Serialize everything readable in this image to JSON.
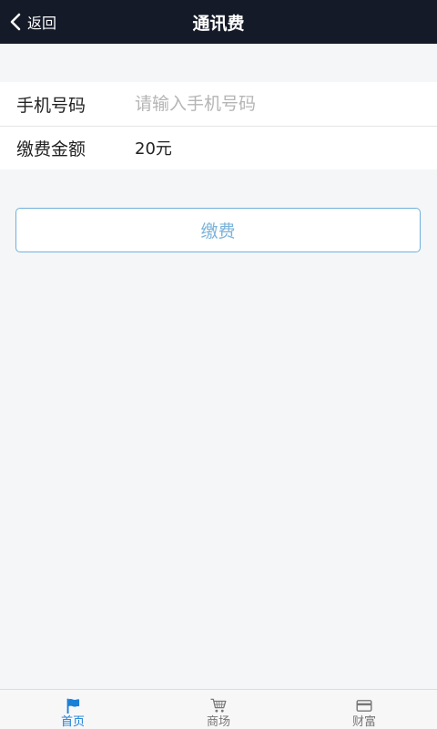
{
  "header": {
    "back_label": "返回",
    "title": "通讯费"
  },
  "form": {
    "phone_label": "手机号码",
    "phone_placeholder": "请输入手机号码",
    "phone_value": "",
    "amount_label": "缴费金额",
    "amount_value": "20元"
  },
  "pay_button_label": "缴费",
  "tabbar": {
    "items": [
      {
        "label": "首页",
        "icon": "flag-icon",
        "active": true
      },
      {
        "label": "商场",
        "icon": "cart-icon",
        "active": false
      },
      {
        "label": "财富",
        "icon": "card-icon",
        "active": false
      }
    ]
  },
  "colors": {
    "topbar_bg": "#141a27",
    "accent": "#1a7fd6",
    "button_border": "#6fb0dc",
    "button_text": "#7ab3da",
    "tab_inactive": "#777777"
  }
}
